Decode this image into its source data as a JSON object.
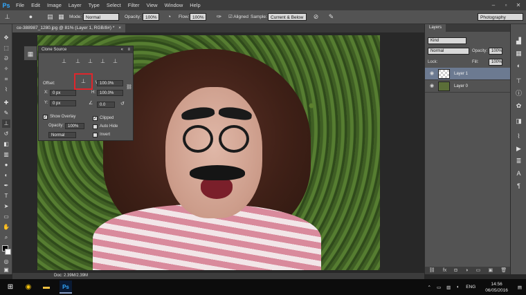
{
  "menubar": {
    "logo": "Ps",
    "items": [
      "File",
      "Edit",
      "Image",
      "Layer",
      "Type",
      "Select",
      "Filter",
      "View",
      "Window",
      "Help"
    ]
  },
  "options": {
    "mode_label": "Mode:",
    "mode_value": "Normal",
    "opacity_label": "Opacity:",
    "opacity_value": "100%",
    "flow_label": "Flow:",
    "flow_value": "100%",
    "aligned_label": "Aligned",
    "sample_label": "Sample:",
    "sample_value": "Current & Below",
    "workspace": "Photography"
  },
  "document": {
    "tab_title": "ce-388987_1280.jpg @ 81% (Layer 1, RGB/8#) *",
    "status": "Doc: 2.39M/2.39M"
  },
  "clone_source": {
    "title": "Clone Source",
    "offset_label": "Offset:",
    "x_label": "X:",
    "x_value": "0 px",
    "y_label": "Y:",
    "y_value": "0 px",
    "w_label": "W:",
    "w_value": "100.0%",
    "h_label": "H:",
    "h_value": "100.0%",
    "angle_value": "0.0",
    "show_overlay": "Show Overlay",
    "opacity_label": "Opacity:",
    "opacity_value": "100%",
    "blend_value": "Normal",
    "clipped": "Clipped",
    "auto_hide": "Auto Hide",
    "invert": "Invert"
  },
  "layers": {
    "tab": "Layers",
    "filter_value": "Kind",
    "blend_value": "Normal",
    "opacity_label": "Opacity:",
    "opacity_value": "100%",
    "lock_label": "Lock:",
    "fill_label": "Fill:",
    "fill_value": "100%",
    "items": [
      {
        "name": "Layer 1",
        "selected": true
      },
      {
        "name": "Layer 0",
        "selected": false
      }
    ]
  },
  "taskbar": {
    "language": "ENG",
    "time": "14:56",
    "date": "06/05/2016"
  },
  "icons": {
    "tools": [
      "move-icon",
      "marquee-icon",
      "lasso-icon",
      "quick-select-icon",
      "crop-icon",
      "eyedropper-icon",
      "healing-icon",
      "brush-icon",
      "clone-stamp-icon",
      "history-brush-icon",
      "eraser-icon",
      "gradient-icon",
      "blur-icon",
      "dodge-icon",
      "pen-icon",
      "type-icon",
      "path-select-icon",
      "shape-icon",
      "hand-icon",
      "zoom-icon"
    ]
  },
  "colors": {
    "accent": "#31a8ff",
    "highlight_box": "#e0262c",
    "selected_layer": "#6c7a91"
  }
}
